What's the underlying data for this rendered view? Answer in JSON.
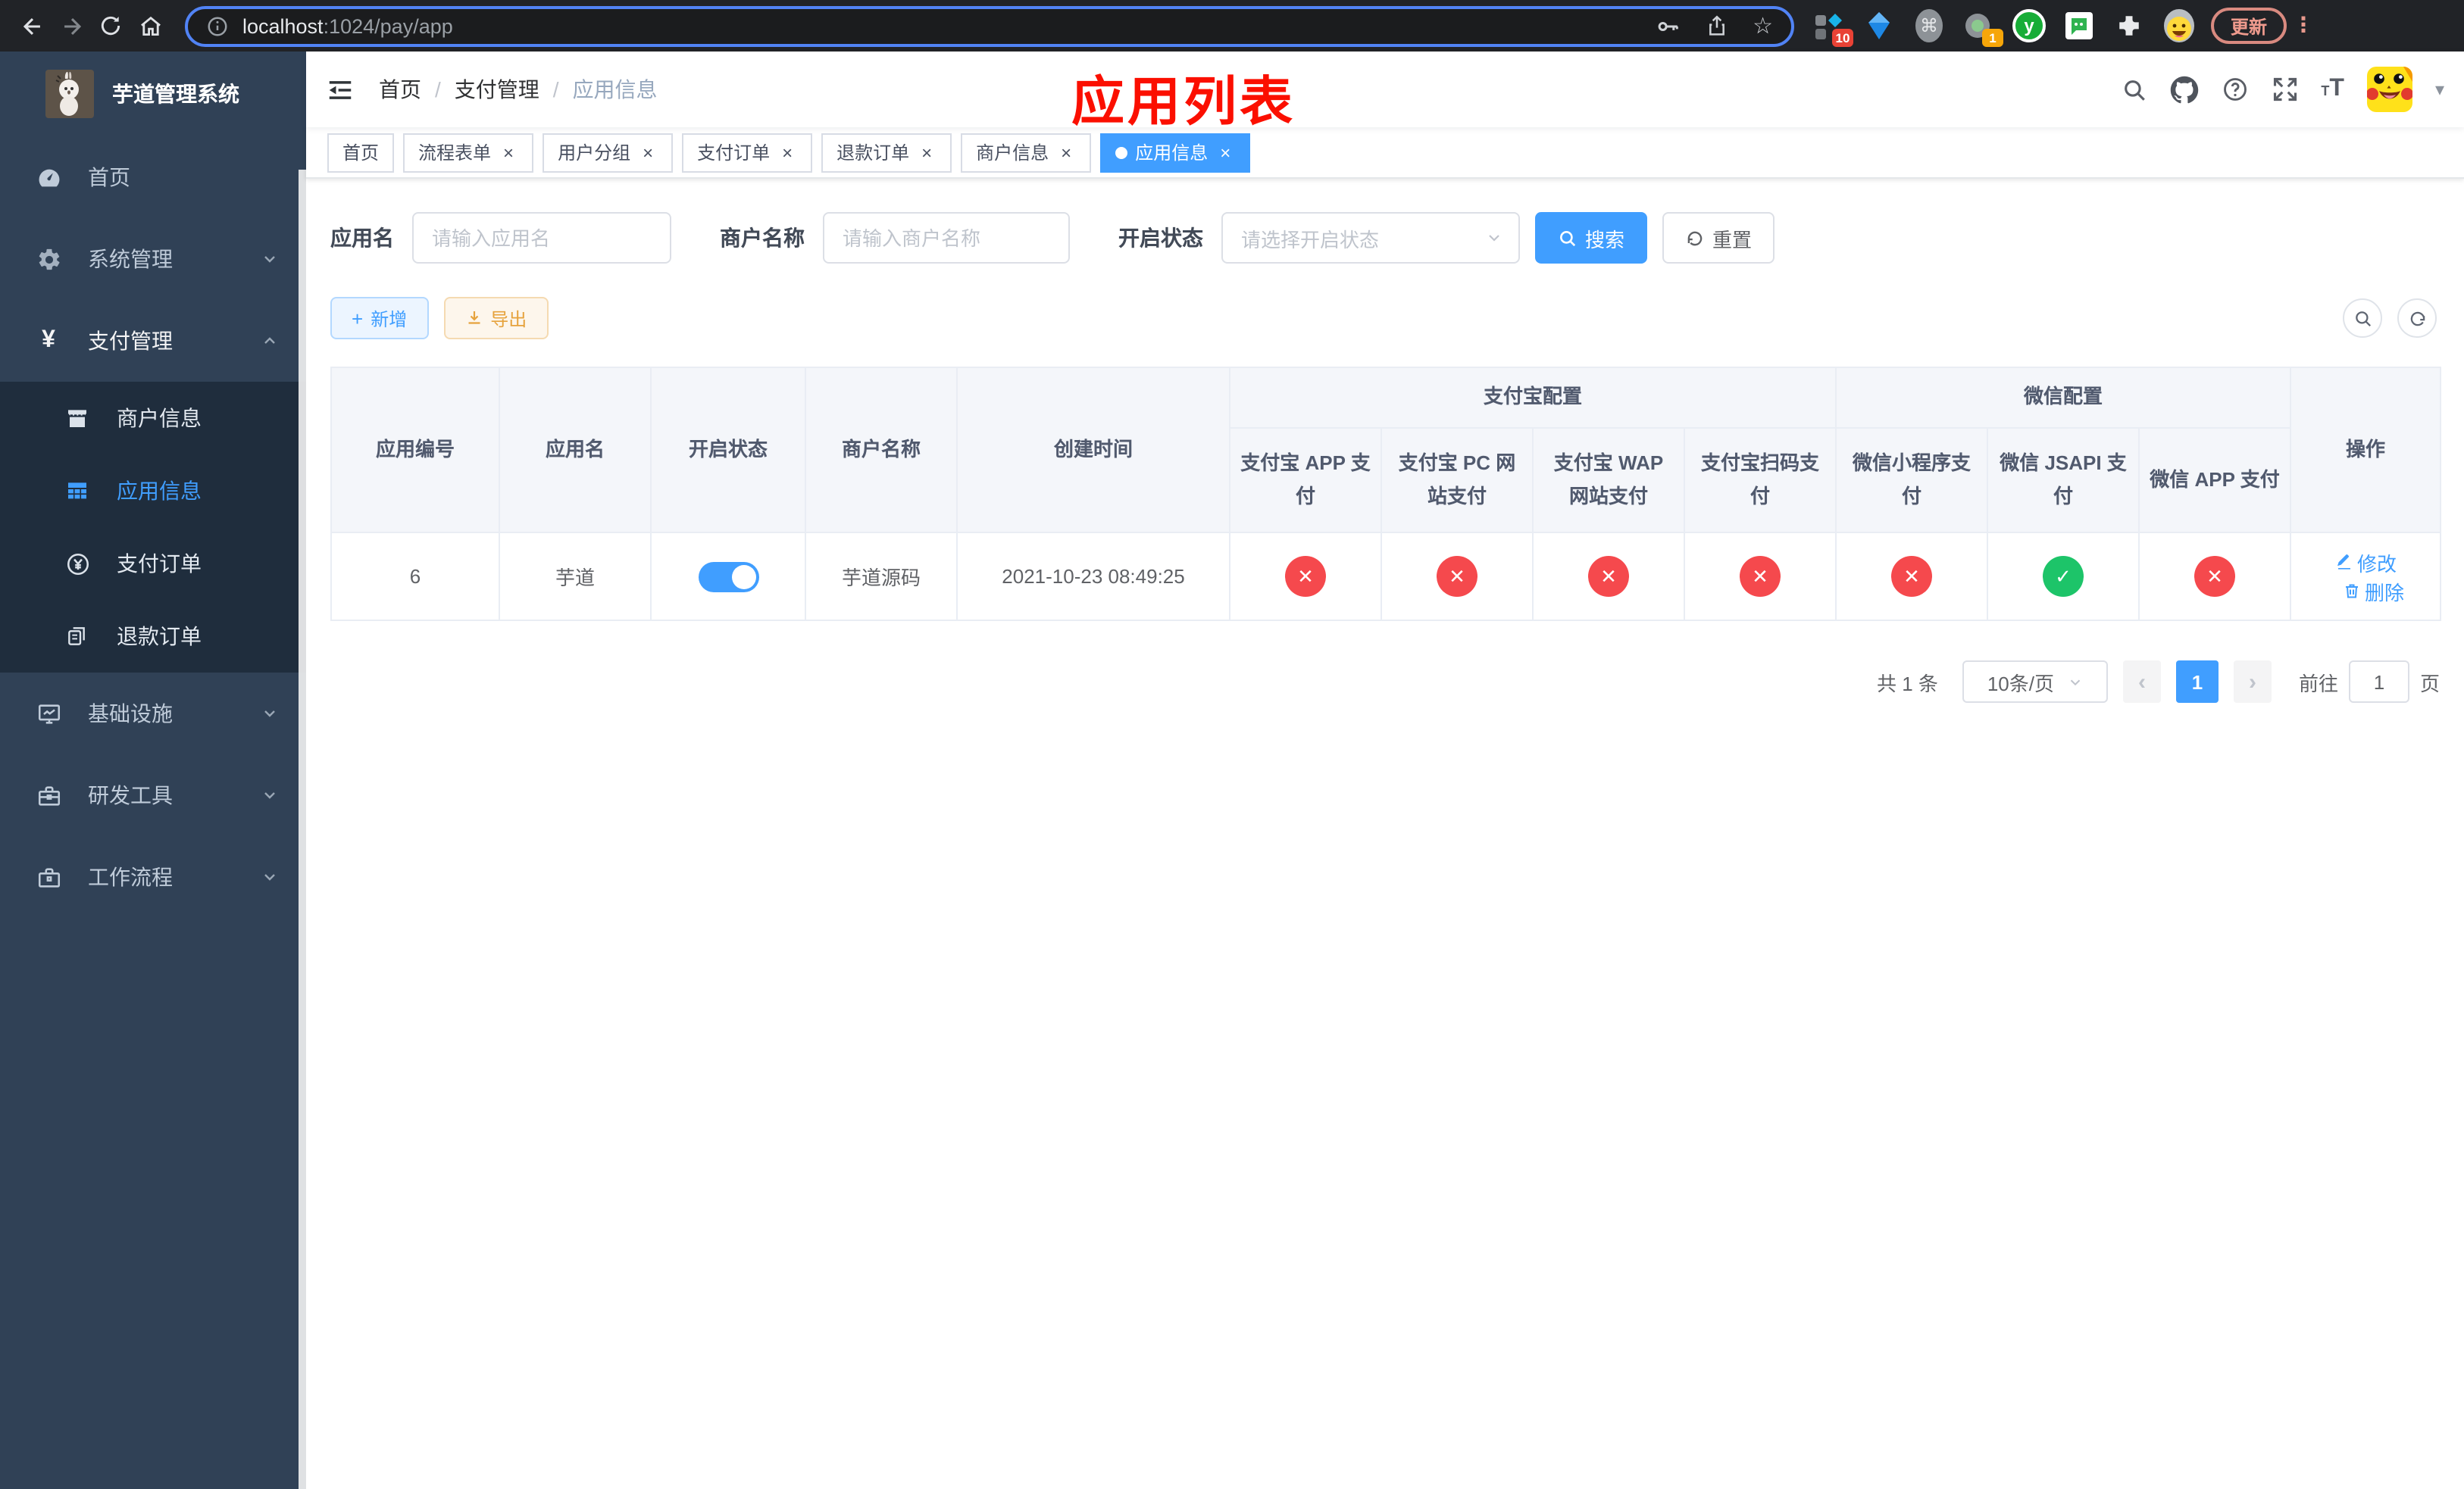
{
  "browser": {
    "url_host": "localhost",
    "url_path": ":1024/pay/app",
    "update_button": "更新",
    "extension_badges": {
      "first": "10",
      "second": "1"
    }
  },
  "sidebar": {
    "logo_title": "芋道管理系统",
    "items": [
      {
        "label": "首页"
      },
      {
        "label": "系统管理"
      },
      {
        "label": "支付管理"
      },
      {
        "label": "商户信息"
      },
      {
        "label": "应用信息"
      },
      {
        "label": "支付订单"
      },
      {
        "label": "退款订单"
      },
      {
        "label": "基础设施"
      },
      {
        "label": "研发工具"
      },
      {
        "label": "工作流程"
      }
    ]
  },
  "navbar": {
    "breadcrumb": {
      "home": "首页",
      "section": "支付管理",
      "current": "应用信息"
    },
    "annotation": "应用列表"
  },
  "tags": [
    {
      "label": "首页"
    },
    {
      "label": "流程表单"
    },
    {
      "label": "用户分组"
    },
    {
      "label": "支付订单"
    },
    {
      "label": "退款订单"
    },
    {
      "label": "商户信息"
    },
    {
      "label": "应用信息"
    }
  ],
  "filters": {
    "app_name_label": "应用名",
    "app_name_placeholder": "请输入应用名",
    "merchant_label": "商户名称",
    "merchant_placeholder": "请输入商户名称",
    "status_label": "开启状态",
    "status_placeholder": "请选择开启状态",
    "search_button": "搜索",
    "reset_button": "重置"
  },
  "toolbar": {
    "add_button": "新增",
    "export_button": "导出"
  },
  "table": {
    "headers": {
      "id": "应用编号",
      "name": "应用名",
      "status": "开启状态",
      "merchant": "商户名称",
      "created": "创建时间",
      "alipay_group": "支付宝配置",
      "wechat_group": "微信配置",
      "actions": "操作",
      "sub": [
        "支付宝 APP 支付",
        "支付宝 PC 网站支付",
        "支付宝 WAP 网站支付",
        "支付宝扫码支付",
        "微信小程序支付",
        "微信 JSAPI 支付",
        "微信 APP 支付"
      ]
    },
    "row": {
      "id": "6",
      "name": "芋道",
      "enabled": true,
      "merchant": "芋道源码",
      "created": "2021-10-23 08:49:25",
      "channel_status": [
        false,
        false,
        false,
        false,
        false,
        true,
        false
      ],
      "edit_label": "修改",
      "delete_label": "删除"
    }
  },
  "pagination": {
    "total": "共 1 条",
    "page_size": "10条/页",
    "current_page": "1",
    "goto_label": "前往",
    "goto_value": "1",
    "goto_unit": "页"
  },
  "colors": {
    "accent": "#409eff",
    "success": "#1dc469",
    "danger": "#f5494d",
    "sidebar_bg": "#304156",
    "submenu_bg": "#1f2d3d",
    "warning": "#e6a23c"
  }
}
